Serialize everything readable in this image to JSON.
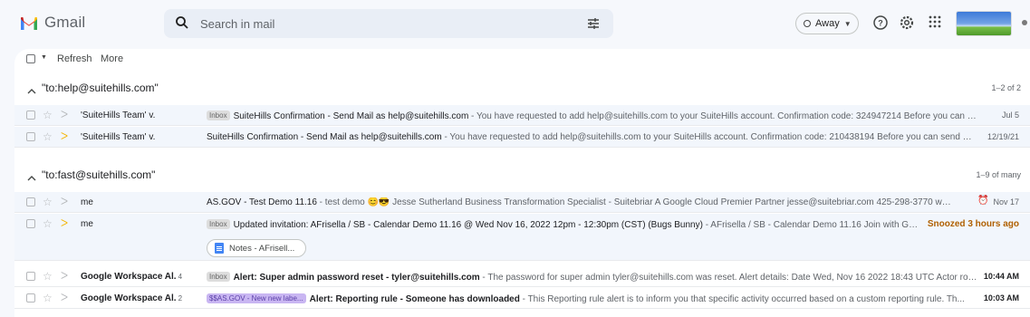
{
  "app": {
    "name": "Gmail"
  },
  "search": {
    "placeholder": "Search in mail"
  },
  "status": {
    "label": "Away"
  },
  "toolbar": {
    "refresh_label": "Refresh",
    "more_label": "More"
  },
  "groups": [
    {
      "title": "\"to:help@suitehills.com\"",
      "count": "1–2 of 2",
      "rows": [
        {
          "sender": "'SuiteHills Team' v.",
          "label": "Inbox",
          "subject": "SuiteHills Confirmation - Send Mail as help@suitehills.com",
          "snippet": " - You have requested to add help@suitehills.com to your SuiteHills account. Confirmation code: 324947214 Before you can s...",
          "date": "Jul 5"
        },
        {
          "sender": "'SuiteHills Team' v.",
          "subject": "SuiteHills Confirmation - Send Mail as help@suitehills.com",
          "snippet": " - You have requested to add help@suitehills.com to your SuiteHills account. Confirmation code: 210438194 Before you can send mai...",
          "date": "12/19/21"
        }
      ]
    },
    {
      "title": "\"to:fast@suitehills.com\"",
      "count": "1–9 of many",
      "rows": [
        {
          "sender": "me",
          "subject": "AS.GOV - Test Demo 11.16",
          "snippet": " - test demo 😊😎 Jesse Sutherland Business Transformation Specialist - Suitebriar A Google Cloud Premier Partner jesse@suitebriar.com 425-298-3770 www.suiteb...",
          "date": "Nov 17"
        },
        {
          "sender": "me",
          "label": "Inbox",
          "subject": "Updated invitation: AFrisella / SB - Calendar Demo 11.16 @ Wed Nov 16, 2022 12pm - 12:30pm (CST) (Bugs Bunny)",
          "snippet": " - AFrisella / SB - Calendar Demo 11.16 Join with Google Me...",
          "date": "Snoozed 3 hours ago",
          "attachment": "Notes - AFrisell..."
        },
        {
          "sender": "Google Workspace Al.",
          "count": "4",
          "label": "Inbox",
          "subject": "Alert: Super admin password reset - tyler@suitehills.com",
          "snippet": " - The password for super admin tyler@suitehills.com was reset. Alert details: Date Wed, Nov 16 2022 18:43 UTC Actor rob...",
          "date": "10:44 AM"
        },
        {
          "sender": "Google Workspace Al.",
          "count": "2",
          "label": "$$AS.GOV - New new labe...",
          "subject": "Alert: Reporting rule - Someone has downloaded",
          "snippet": " - This Reporting rule alert is to inform you that specific activity occurred based on a custom reporting rule. Th...",
          "date": "10:03 AM"
        }
      ]
    }
  ]
}
